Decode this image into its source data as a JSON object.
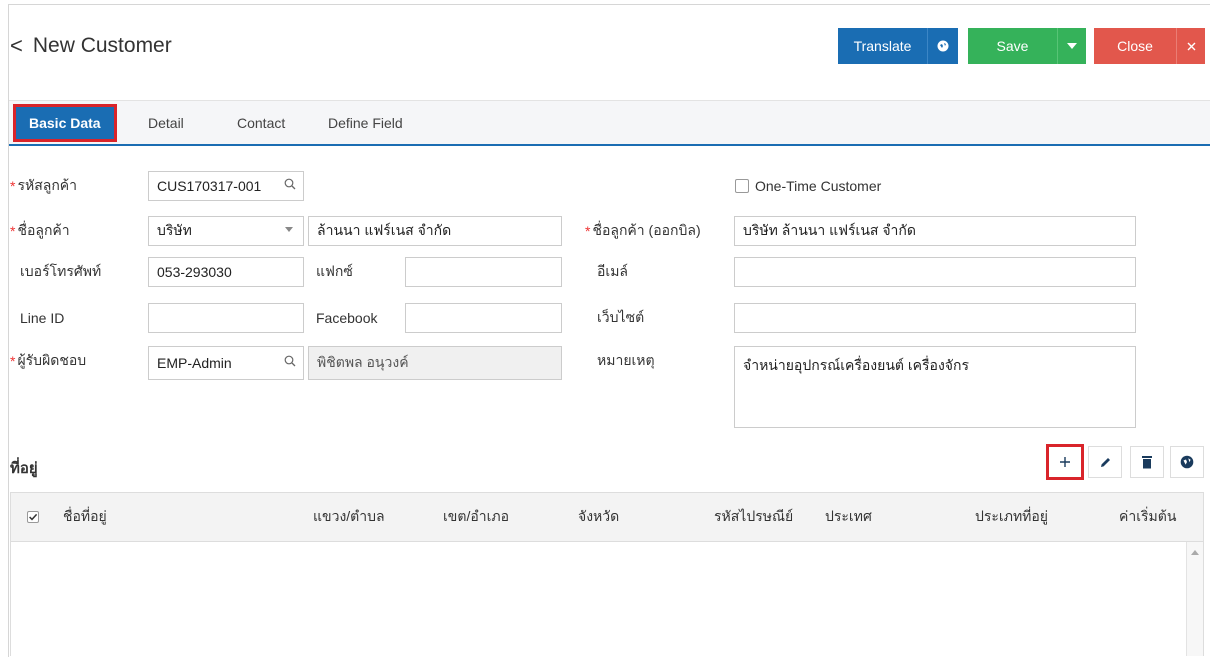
{
  "header": {
    "back_symbol": "<",
    "title": "New Customer",
    "translate_label": "Translate",
    "save_label": "Save",
    "close_label": "Close"
  },
  "tabs": [
    {
      "label": "Basic Data",
      "active": true
    },
    {
      "label": "Detail",
      "active": false
    },
    {
      "label": "Contact",
      "active": false
    },
    {
      "label": "Define Field",
      "active": false
    }
  ],
  "form": {
    "customer_code_label": "รหัสลูกค้า",
    "customer_code_value": "CUS170317-001",
    "one_time_label": "One-Time Customer",
    "one_time_checked": false,
    "customer_name_label": "ชื่อลูกค้า",
    "customer_type_value": "บริษัท",
    "customer_name_value": "ล้านนา แฟร์เนส จำกัด",
    "billing_name_label": "ชื่อลูกค้า (ออกบิล)",
    "billing_name_value": "บริษัท ล้านนา แฟร์เนส จำกัด",
    "phone_label": "เบอร์โทรศัพท์",
    "phone_value": "053-293030",
    "fax_label": "แฟกซ์",
    "fax_value": "",
    "email_label": "อีเมล์",
    "email_value": "",
    "line_label": "Line ID",
    "line_value": "",
    "facebook_label": "Facebook",
    "facebook_value": "",
    "website_label": "เว็บไซต์",
    "website_value": "",
    "owner_label": "ผู้รับผิดชอบ",
    "owner_code_value": "EMP-Admin",
    "owner_name_value": "พิชิตพล อนุวงค์",
    "remark_label": "หมายเหตุ",
    "remark_value": "จำหน่ายอุปกรณ์เครื่องยนต์ เครื่องจักร"
  },
  "address": {
    "section_title": "ที่อยู่",
    "columns": [
      "ชื่อที่อยู่",
      "แขวง/ตำบล",
      "เขต/อำเภอ",
      "จังหวัด",
      "รหัสไปรษณีย์",
      "ประเทศ",
      "ประเภทที่อยู่",
      "ค่าเริ่มต้น"
    ],
    "rows": []
  },
  "colors": {
    "primary": "#1a6db3",
    "success": "#35b25a",
    "danger": "#e2574c",
    "highlight": "#d9242a"
  }
}
